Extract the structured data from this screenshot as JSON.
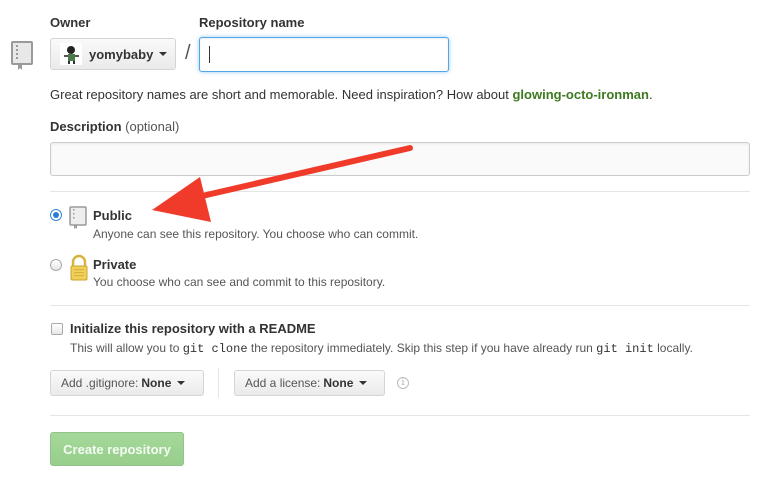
{
  "owner": {
    "label": "Owner",
    "selected": "yomybaby"
  },
  "repo_name": {
    "label": "Repository name",
    "value": "",
    "separator": "/"
  },
  "hint": {
    "text": "Great repository names are short and memorable. Need inspiration? How about",
    "suggestion": "glowing-octo-ironman",
    "end": "."
  },
  "description": {
    "label": "Description",
    "optional": "(optional)",
    "value": ""
  },
  "visibility": {
    "public": {
      "title": "Public",
      "desc": "Anyone can see this repository. You choose who can commit.",
      "checked": true
    },
    "private": {
      "title": "Private",
      "desc": "You choose who can see and commit to this repository.",
      "checked": false
    }
  },
  "readme": {
    "title": "Initialize this repository with a README",
    "desc_1": "This will allow you to",
    "code_1": "git clone",
    "desc_2": "the repository immediately. Skip this step if you have already run",
    "code_2": "git init",
    "desc_3": "locally.",
    "checked": false
  },
  "gitignore": {
    "label": "Add .gitignore:",
    "value": "None"
  },
  "license": {
    "label": "Add a license:",
    "value": "None"
  },
  "info_icon": "info-icon",
  "create_button": "Create repository",
  "colors": {
    "accent_blue": "#51a7e8",
    "suggestion_green": "#3c7a1f",
    "create_button_green": "#97ce8b",
    "arrow_red": "#f03a2a"
  }
}
